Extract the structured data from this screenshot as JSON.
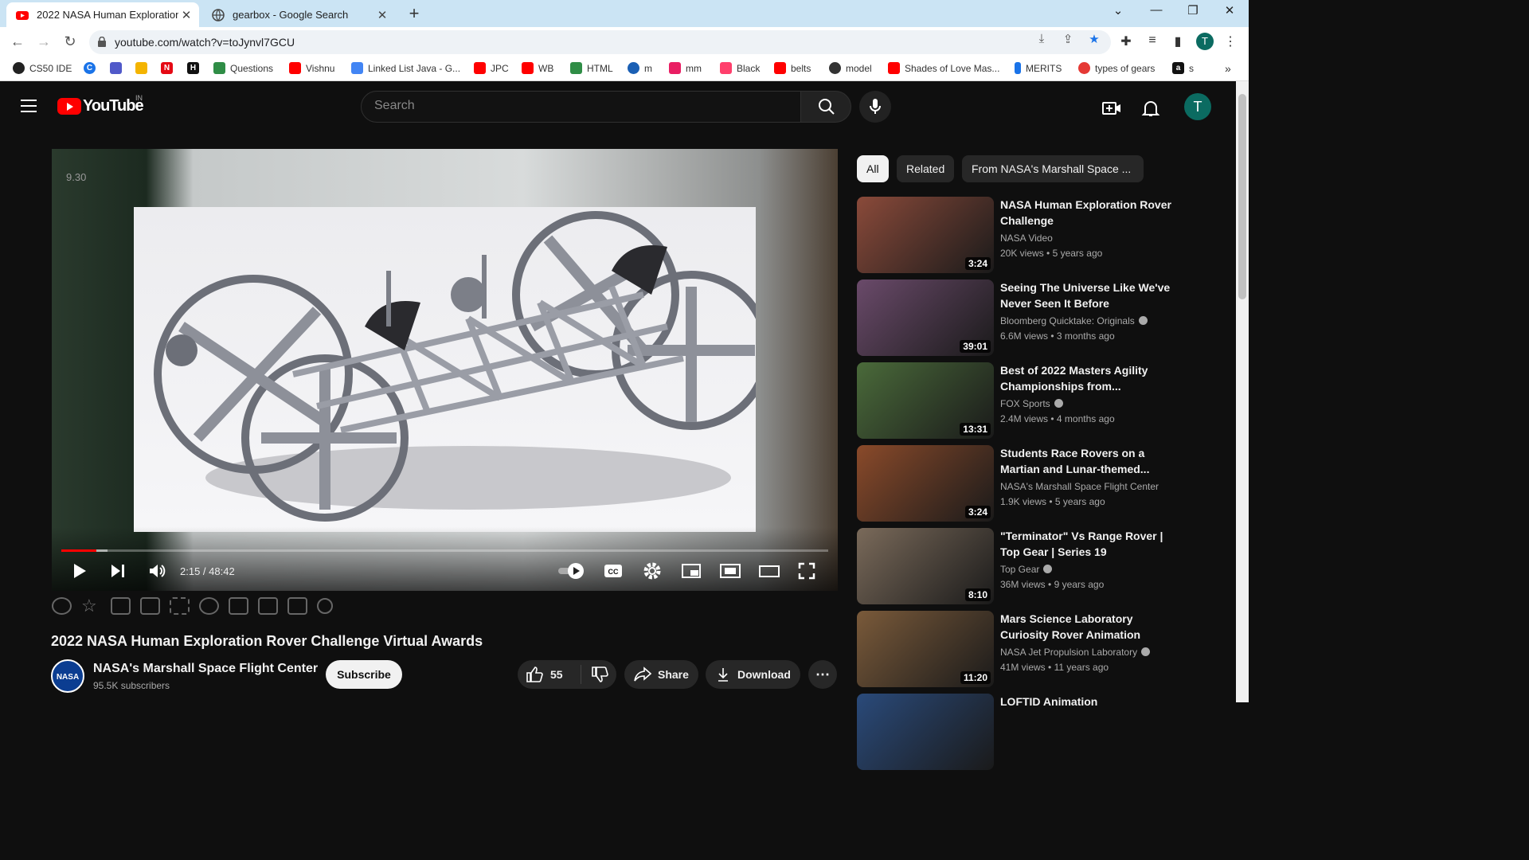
{
  "browser": {
    "tabs": [
      {
        "title": "2022 NASA Human Exploration R",
        "icon": "youtube-icon"
      },
      {
        "title": "gearbox - Google Search",
        "icon": "globe-icon"
      }
    ],
    "url": "youtube.com/watch?v=toJynvl7GCU",
    "bookmarks": [
      "CS50 IDE",
      "",
      "",
      "",
      "",
      "Questions",
      "Vishnu",
      "Linked List Java - G...",
      "JPC",
      "WB",
      "HTML",
      "m",
      "mm",
      "Black",
      "belts",
      "model",
      "Shades of Love Mas...",
      "MERITS",
      "types of gears",
      "s"
    ],
    "profile_initial": "T"
  },
  "youtube": {
    "logo_text": "YouTube",
    "country": "IN",
    "search_placeholder": "Search",
    "avatar_initial": "T"
  },
  "player": {
    "overlay_text": "9.30",
    "time": "2:15 / 48:42",
    "progress_fraction": 0.046
  },
  "video": {
    "title": "2022 NASA Human Exploration Rover Challenge Virtual Awards",
    "channel": "NASA's Marshall Space Flight Center",
    "channel_avatar": "NASA",
    "subscribers": "95.5K subscribers",
    "subscribe_label": "Subscribe",
    "likes": "55",
    "share_label": "Share",
    "download_label": "Download"
  },
  "chips": [
    "All",
    "Related",
    "From NASA's Marshall Space ..."
  ],
  "recommendations": [
    {
      "title": "NASA Human Exploration Rover Challenge",
      "channel": "NASA Video",
      "verified": false,
      "views": "20K views",
      "age": "5 years ago",
      "duration": "3:24",
      "thumb": "#8a4a3a"
    },
    {
      "title": "Seeing The Universe Like We've Never Seen It Before",
      "channel": "Bloomberg Quicktake: Originals",
      "verified": true,
      "views": "6.6M views",
      "age": "3 months ago",
      "duration": "39:01",
      "thumb": "#6a4a6a"
    },
    {
      "title": "Best of 2022 Masters Agility Championships from...",
      "channel": "FOX Sports",
      "verified": true,
      "views": "2.4M views",
      "age": "4 months ago",
      "duration": "13:31",
      "thumb": "#4a6a3a"
    },
    {
      "title": "Students Race Rovers on a Martian and Lunar-themed...",
      "channel": "NASA's Marshall Space Flight Center",
      "verified": false,
      "views": "1.9K views",
      "age": "5 years ago",
      "duration": "3:24",
      "thumb": "#8a4a2a"
    },
    {
      "title": "\"Terminator\" Vs Range Rover | Top Gear | Series 19",
      "channel": "Top Gear",
      "verified": true,
      "views": "36M views",
      "age": "9 years ago",
      "duration": "8:10",
      "thumb": "#7a6a5a"
    },
    {
      "title": "Mars Science Laboratory Curiosity Rover Animation",
      "channel": "NASA Jet Propulsion Laboratory",
      "verified": true,
      "views": "41M views",
      "age": "11 years ago",
      "duration": "11:20",
      "thumb": "#7a5a3a"
    },
    {
      "title": "LOFTID Animation",
      "channel": "",
      "verified": false,
      "views": "",
      "age": "",
      "duration": "",
      "thumb": "#2a4a7a"
    }
  ]
}
